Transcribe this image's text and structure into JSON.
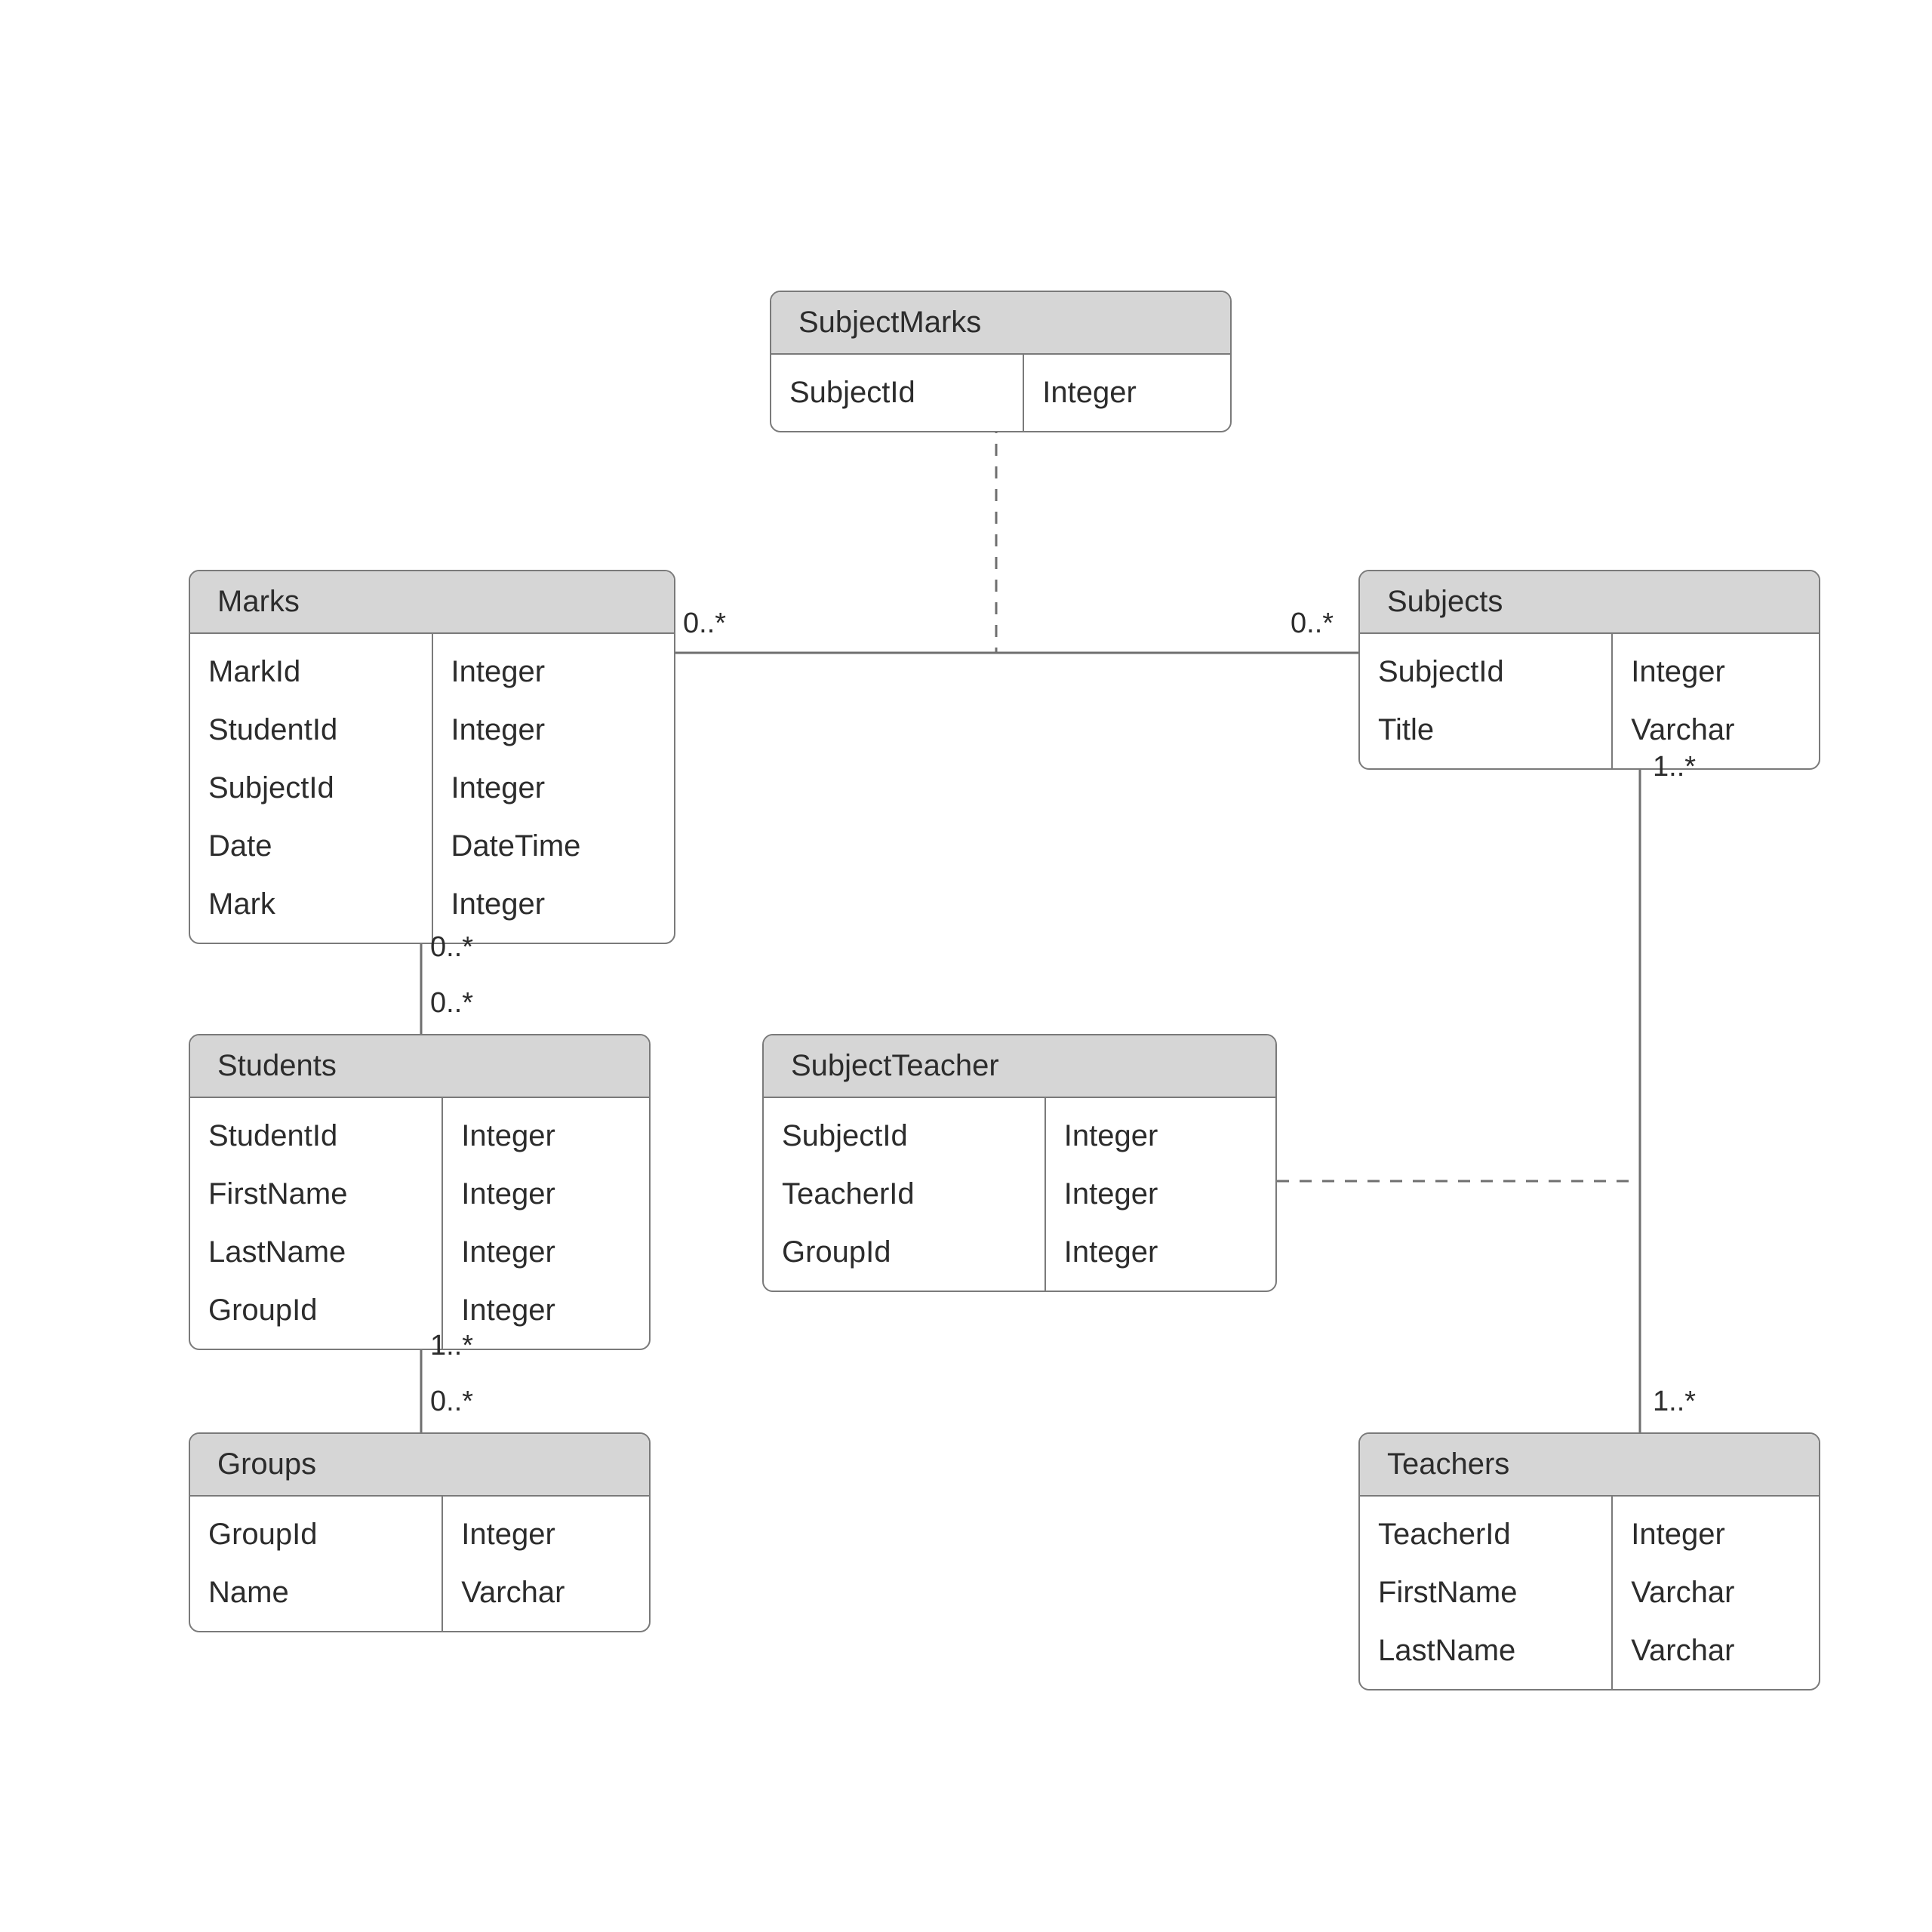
{
  "entities": {
    "subjectMarks": {
      "title": "SubjectMarks",
      "fields": [
        {
          "name": "SubjectId",
          "type": "Integer"
        }
      ]
    },
    "marks": {
      "title": "Marks",
      "fields": [
        {
          "name": "MarkId",
          "type": "Integer"
        },
        {
          "name": "StudentId",
          "type": "Integer"
        },
        {
          "name": "SubjectId",
          "type": "Integer"
        },
        {
          "name": "Date",
          "type": "DateTime"
        },
        {
          "name": "Mark",
          "type": "Integer"
        }
      ]
    },
    "subjects": {
      "title": "Subjects",
      "fields": [
        {
          "name": "SubjectId",
          "type": "Integer"
        },
        {
          "name": "Title",
          "type": "Varchar"
        }
      ]
    },
    "students": {
      "title": "Students",
      "fields": [
        {
          "name": "StudentId",
          "type": "Integer"
        },
        {
          "name": "FirstName",
          "type": "Integer"
        },
        {
          "name": "LastName",
          "type": "Integer"
        },
        {
          "name": "GroupId",
          "type": "Integer"
        }
      ]
    },
    "subjectTeacher": {
      "title": "SubjectTeacher",
      "fields": [
        {
          "name": "SubjectId",
          "type": "Integer"
        },
        {
          "name": "TeacherId",
          "type": "Integer"
        },
        {
          "name": "GroupId",
          "type": "Integer"
        }
      ]
    },
    "groups": {
      "title": "Groups",
      "fields": [
        {
          "name": "GroupId",
          "type": "Integer"
        },
        {
          "name": "Name",
          "type": "Varchar"
        }
      ]
    },
    "teachers": {
      "title": "Teachers",
      "fields": [
        {
          "name": "TeacherId",
          "type": "Integer"
        },
        {
          "name": "FirstName",
          "type": "Varchar"
        },
        {
          "name": "LastName",
          "type": "Varchar"
        }
      ]
    }
  },
  "cardinalities": {
    "marksToSubjectsLeft": "0..*",
    "marksToSubjectsRight": "0..*",
    "marksToStudentsTop": "0..*",
    "marksToStudentsBot": "0..*",
    "studentsToGroupsTop": "1..*",
    "studentsToGroupsBot": "0..*",
    "subjectsToTeachersTop": "1..*",
    "subjectsToTeachersBot": "1..*"
  }
}
